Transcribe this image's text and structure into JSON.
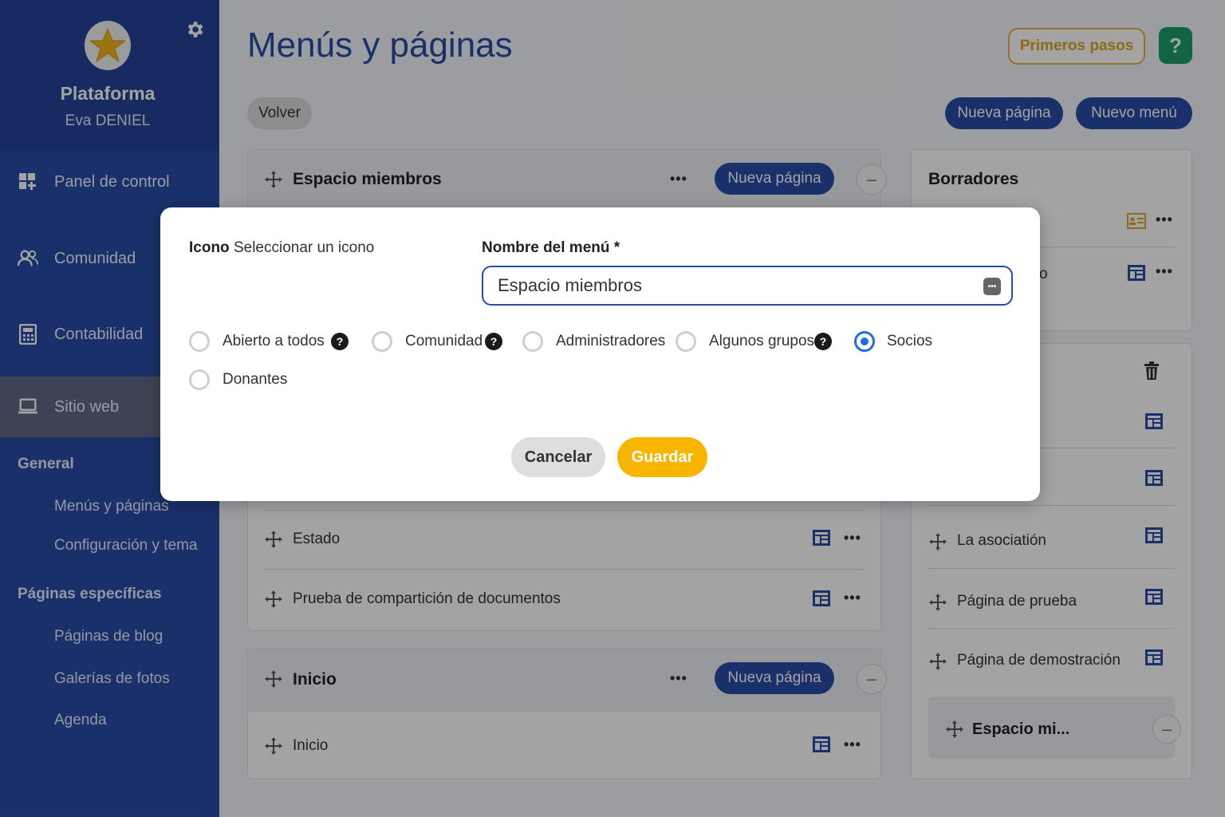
{
  "sidebar": {
    "brand_name": "Plataforma",
    "user_name": "Eva DENIEL",
    "nav": [
      {
        "label": "Panel de control",
        "icon": "dashboard-icon"
      },
      {
        "label": "Comunidad",
        "icon": "community-icon"
      },
      {
        "label": "Contabilidad",
        "icon": "calculator-icon"
      },
      {
        "label": "Sitio web",
        "icon": "laptop-icon",
        "active": true
      }
    ],
    "sections": [
      {
        "heading": "General",
        "links": [
          "Menús y páginas",
          "Configuración y tema"
        ]
      },
      {
        "heading": "Páginas específicas",
        "links": [
          "Páginas de blog",
          "Galerías de fotos",
          "Agenda"
        ]
      }
    ]
  },
  "header": {
    "title": "Menús y páginas",
    "first_steps": "Primeros pasos",
    "help": "?",
    "back": "Volver",
    "new_page": "Nueva página",
    "new_menu": "Nuevo menú"
  },
  "menus": [
    {
      "title": "Espacio miembros",
      "new_page": "Nueva página",
      "more": "•••",
      "collapse": "–",
      "pages": [
        "Estado",
        "Prueba de compartición de documentos"
      ]
    },
    {
      "title": "Inicio",
      "new_page": "Nueva página",
      "more": "•••",
      "collapse": "–",
      "pages": [
        "Inicio"
      ]
    }
  ],
  "drafts": {
    "title": "Borradores",
    "partial_text": "o",
    "pages": [
      "La asociatión",
      "Página de prueba",
      "Página de demostración"
    ],
    "submenu": "Espacio mi...",
    "collapse": "–"
  },
  "modal": {
    "icon_label": "Icono",
    "icon_select": "Seleccionar un icono",
    "name_label": "Nombre del menú *",
    "name_value": "Espacio miembros",
    "input_btn": "•••",
    "options": [
      {
        "label": "Abierto a todos",
        "checked": false,
        "help": true
      },
      {
        "label": "Comunidad",
        "checked": false,
        "help": true
      },
      {
        "label": "Administradores",
        "checked": false,
        "help": false
      },
      {
        "label": "Algunos grupos",
        "checked": false,
        "help": true
      },
      {
        "label": "Socios",
        "checked": true,
        "help": false
      },
      {
        "label": "Donantes",
        "checked": false,
        "help": false
      }
    ],
    "help_glyph": "?",
    "cancel": "Cancelar",
    "save": "Guardar"
  },
  "colors": {
    "brand_blue": "#2a4ca6",
    "save_yellow": "#f7b500",
    "help_green": "#1d9e6a",
    "radio_blue": "#1f6ee0"
  }
}
